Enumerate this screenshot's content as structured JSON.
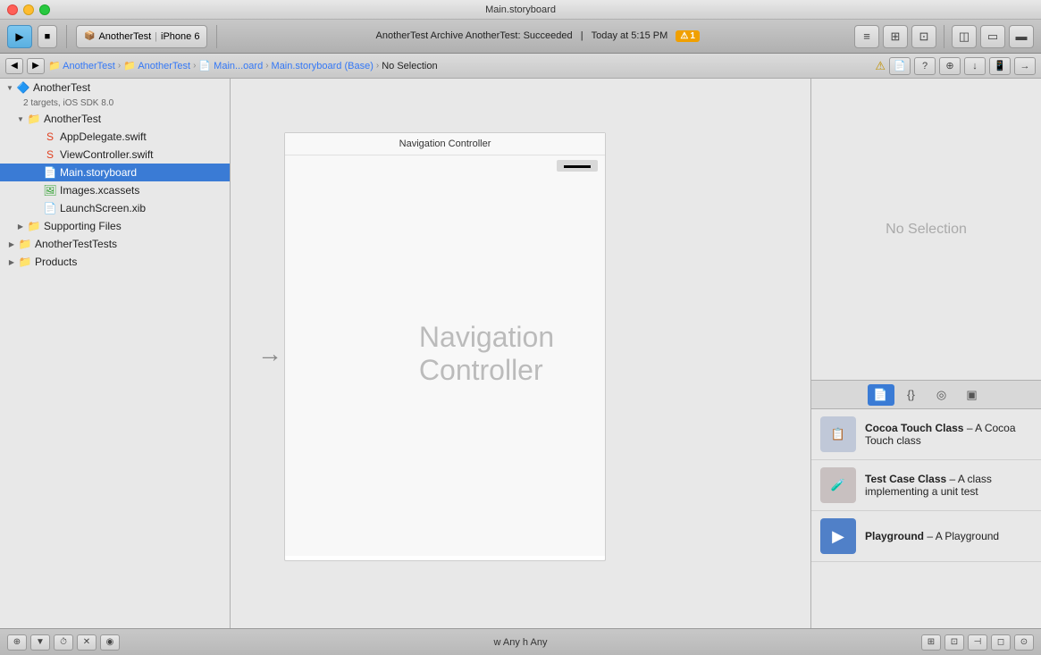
{
  "titleBar": {
    "title": "Main.storyboard"
  },
  "toolbar": {
    "playLabel": "▶",
    "stopLabel": "■",
    "scheme": "AnotherTest",
    "device": "iPhone 6",
    "statusText": "AnotherTest   Archive AnotherTest: Succeeded",
    "timeText": "Today at 5:15 PM",
    "warningCount": "1",
    "icons": {
      "editor1": "≡",
      "editor2": "⊞",
      "editor3": "⊡",
      "panel1": "◫",
      "panel2": "▭",
      "panel3": "▬"
    }
  },
  "secondToolbar": {
    "breadcrumbs": [
      "AnotherTest",
      "AnotherTest",
      "Main...oard",
      "Main.storyboard (Base)",
      "No Selection"
    ],
    "warningIcon": "⚠"
  },
  "sidebar": {
    "items": [
      {
        "id": "anothertest-root",
        "label": "AnotherTest",
        "type": "project",
        "level": 0,
        "open": true
      },
      {
        "id": "targets-label",
        "label": "2 targets, iOS SDK 8.0",
        "type": "meta",
        "level": 1
      },
      {
        "id": "anothertest-group",
        "label": "AnotherTest",
        "type": "folder",
        "level": 1,
        "open": true
      },
      {
        "id": "appdelegate",
        "label": "AppDelegate.swift",
        "type": "swift",
        "level": 2
      },
      {
        "id": "viewcontroller",
        "label": "ViewController.swift",
        "type": "swift",
        "level": 2
      },
      {
        "id": "main-storyboard",
        "label": "Main.storyboard",
        "type": "storyboard",
        "level": 2,
        "selected": true
      },
      {
        "id": "images",
        "label": "Images.xcassets",
        "type": "xcassets",
        "level": 2
      },
      {
        "id": "launchscreen",
        "label": "LaunchScreen.xib",
        "type": "xib",
        "level": 2
      },
      {
        "id": "supporting-files",
        "label": "Supporting Files",
        "type": "folder",
        "level": 2,
        "open": false
      },
      {
        "id": "anothertest-tests",
        "label": "AnotherTestTests",
        "type": "folder",
        "level": 1,
        "open": false
      },
      {
        "id": "products",
        "label": "Products",
        "type": "folder",
        "level": 1,
        "open": false
      }
    ]
  },
  "canvas": {
    "navControllerTitle": "Navigation Controller",
    "navBarLabel": "▬▬",
    "navControllerBody": "Navigation Controller",
    "arrowLabel": "→"
  },
  "rightPanel": {
    "noSelectionText": "No Selection",
    "tabs": [
      {
        "id": "file-tab",
        "icon": "📄",
        "label": "file",
        "active": true
      },
      {
        "id": "quick-help-tab",
        "icon": "{}",
        "label": "quick-help"
      },
      {
        "id": "settings-tab",
        "icon": "◎",
        "label": "settings"
      },
      {
        "id": "identity-tab",
        "icon": "▣",
        "label": "identity"
      }
    ],
    "libraryItems": [
      {
        "id": "cocoa-touch-class",
        "title": "Cocoa Touch Class",
        "titleBold": "Cocoa Touch Class",
        "desc": "– A Cocoa Touch class",
        "icon": "📋"
      },
      {
        "id": "test-case-class",
        "title": "Test Case Class",
        "titleBold": "Test Case Class",
        "desc": "– A class implementing a unit test",
        "icon": "🧪"
      },
      {
        "id": "playground",
        "title": "Playground",
        "titleBold": "Playground",
        "desc": "– A Playground",
        "icon": "▶"
      }
    ]
  },
  "bottomBar": {
    "leftIcons": [
      "⊕",
      "▼",
      "⏱",
      "✕",
      "◉"
    ],
    "centerText": "w Any h Any",
    "rightIcons": [
      "⊞",
      "⊡",
      "⊣",
      "◻",
      "⊙"
    ]
  }
}
